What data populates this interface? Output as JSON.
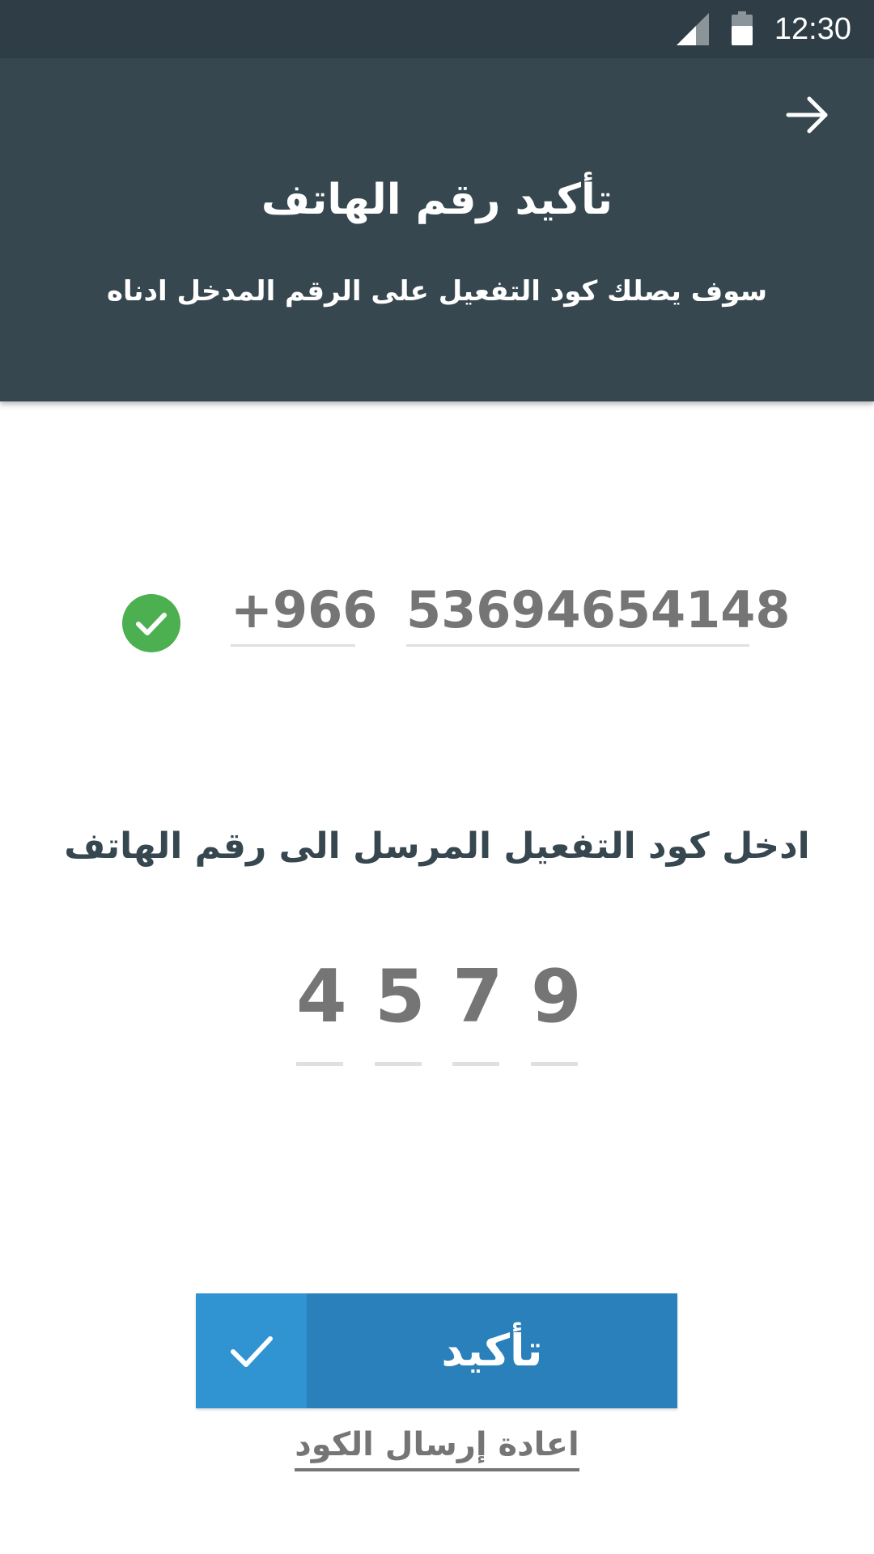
{
  "status_bar": {
    "time": "12:30"
  },
  "header": {
    "title": "تأكيد رقم الهاتف",
    "subtitle": "سوف يصلك كود التفعيل على الرقم المدخل ادناه",
    "background": "#37474f"
  },
  "phone": {
    "country_code": "+966",
    "number": "53694654148",
    "verified": true,
    "verified_color": "#4caf50"
  },
  "code": {
    "label": "ادخل كود التفعيل المرسل الى رقم الهاتف",
    "digits": [
      "4",
      "5",
      "7",
      "9"
    ]
  },
  "confirm_button": {
    "label": "تأكيد",
    "color": "#2a80bb",
    "icon_bg": "#3093d2"
  },
  "resend": {
    "label": "اعادة إرسال الكود"
  }
}
